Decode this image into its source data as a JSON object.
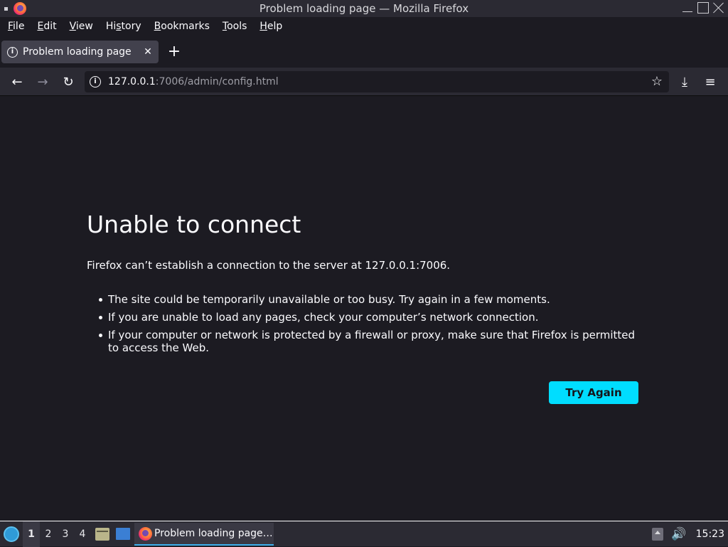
{
  "window": {
    "title": "Problem loading page — Mozilla Firefox"
  },
  "menubar": {
    "items": [
      {
        "label": "File",
        "accel": "F",
        "rest": "ile"
      },
      {
        "label": "Edit",
        "accel": "E",
        "rest": "dit"
      },
      {
        "label": "View",
        "accel": "V",
        "rest": "iew"
      },
      {
        "label": "History",
        "pre": "Hi",
        "accel": "s",
        "rest": "tory"
      },
      {
        "label": "Bookmarks",
        "accel": "B",
        "rest": "ookmarks"
      },
      {
        "label": "Tools",
        "accel": "T",
        "rest": "ools"
      },
      {
        "label": "Help",
        "accel": "H",
        "rest": "elp"
      }
    ]
  },
  "tabs": {
    "active_label": "Problem loading page",
    "close_glyph": "✕",
    "new_tab_glyph": "+"
  },
  "navbar": {
    "back_glyph": "←",
    "forward_glyph": "→",
    "reload_glyph": "↻",
    "url_host": "127.0.0.1",
    "url_rest": ":7006/admin/config.html",
    "bookmark_glyph": "☆",
    "download_glyph": "⤓",
    "menu_glyph": "≡"
  },
  "error": {
    "title": "Unable to connect",
    "description": "Firefox can’t establish a connection to the server at 127.0.0.1:7006.",
    "bullets": [
      "The site could be temporarily unavailable or too busy. Try again in a few moments.",
      "If you are unable to load any pages, check your computer’s network connection.",
      "If your computer or network is protected by a firewall or proxy, make sure that Firefox is permitted to access the Web."
    ],
    "button_label": "Try Again",
    "button_color": "#00ddff"
  },
  "taskbar": {
    "workspaces": [
      "1",
      "2",
      "3",
      "4"
    ],
    "active_workspace": "1",
    "task_label": "Problem loading page…",
    "volume_glyph": "🔊",
    "clock": "15:23"
  }
}
